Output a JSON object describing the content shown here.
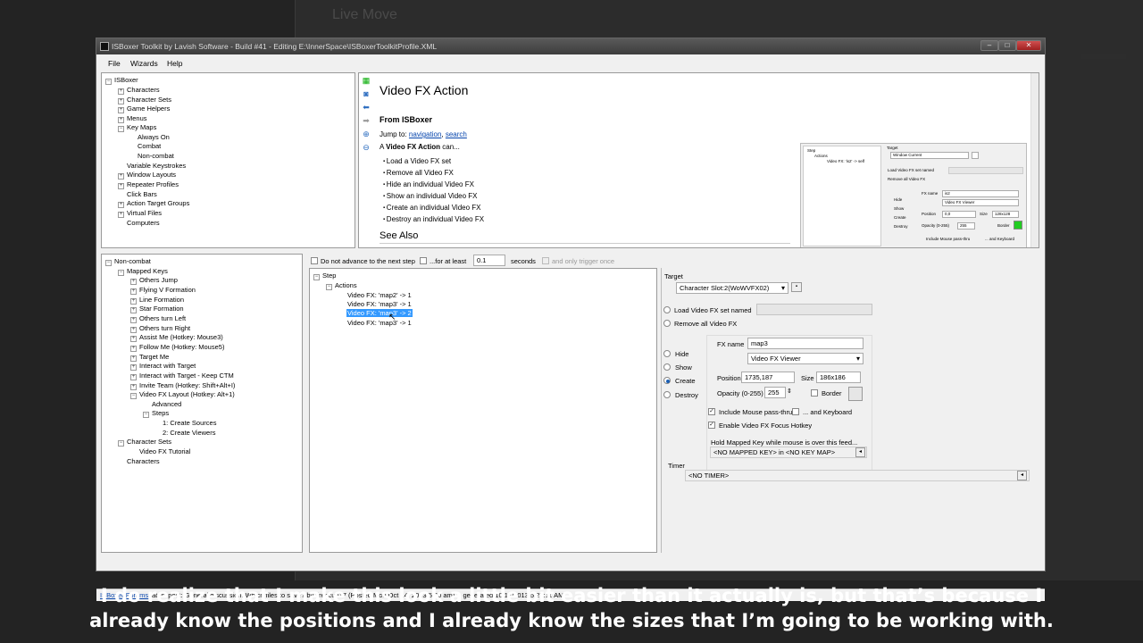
{
  "window": {
    "title": "ISBoxer Toolkit by Lavish Software - Build #41 - Editing E:\\InnerSpace\\ISBoxerToolkitProfile.XML",
    "background_title": "Live Move"
  },
  "menu": [
    "File",
    "Wizards",
    "Help"
  ],
  "top_tree": {
    "root": "ISBoxer",
    "items": [
      "Characters",
      "Character Sets",
      "Game Helpers",
      "Menus",
      "Key Maps",
      "Always On",
      "Combat",
      "Non-combat",
      "Variable Keystrokes",
      "Window Layouts",
      "Repeater Profiles",
      "Click Bars",
      "Action Target Groups",
      "Virtual Files",
      "Computers"
    ]
  },
  "help": {
    "title": "Video FX Action",
    "section": "From ISBoxer",
    "jump_to": "Jump to:",
    "nav_link": "navigation",
    "search_link": "search",
    "intro_bold": "Video FX Action",
    "intro_rest": "can...",
    "bullets": [
      "Load a Video FX set",
      "Remove all Video FX",
      "Hide an individual Video FX",
      "Show an individual Video FX",
      "Create an individual Video FX",
      "Destroy an individual Video FX"
    ],
    "see_also": "See Also"
  },
  "bottom_tree": {
    "root": "Non-combat",
    "items": [
      "Mapped Keys",
      "Others Jump",
      "Flying V Formation",
      "Line Formation",
      "Star Formation",
      "Others turn Left",
      "Others turn Right",
      "Assist Me (Hotkey: Mouse3)",
      "Follow Me (Hotkey: Mouse5)",
      "Target Me",
      "Interact with Target",
      "Interact with Target - Keep CTM",
      "Invite Team (Hotkey: Shift+Alt+I)",
      "Video FX Layout (Hotkey: Alt+1)",
      "Advanced",
      "Steps",
      "1: Create Sources",
      "2: Create Viewers",
      "Character Sets",
      "Video FX Tutorial",
      "Characters"
    ]
  },
  "step_options": {
    "no_advance": "Do not advance to the next step",
    "for_at_least": "...for at least",
    "seconds_value": "0.1",
    "seconds": "seconds",
    "only_once": "and only trigger once"
  },
  "step_tree": {
    "step": "Step",
    "actions": "Actions",
    "items": [
      "Video FX: 'map2' -> 1",
      "Video FX: 'map3' -> 1",
      "Video FX: 'map3' -> 2",
      "Video FX: 'map3' -> 1"
    ]
  },
  "action": {
    "target_label": "Target",
    "target_value": "Character Slot:2(WoWVFX02)",
    "load_set": "Load Video FX set named",
    "remove_all": "Remove all Video FX",
    "hide": "Hide",
    "show": "Show",
    "create": "Create",
    "destroy": "Destroy",
    "fx_name_label": "FX name",
    "fx_name": "map3",
    "fx_type": "Video FX Viewer",
    "position_label": "Position",
    "position": "1735,187",
    "size_label": "Size",
    "size": "186x186",
    "opacity_label": "Opacity (0-255)",
    "opacity": "255",
    "border": "Border",
    "mouse_passthru": "Include Mouse pass-thru",
    "and_keyboard": "... and Keyboard",
    "focus_hotkey": "Enable Video FX Focus Hotkey",
    "hold_mapped": "Hold Mapped Key while mouse is over this feed...",
    "mapped_key": "<NO MAPPED KEY> in <NO KEY MAP>",
    "timer_label": "Timer",
    "timer": "<NO TIMER>"
  },
  "status": {
    "link": "ISBoxer Forums",
    "text": "latest post: General discussion: Which files to save? by firescue17 (Posted Mon Oct 14, 2013 5:00 am) -- generated 10/14/2013 5:27:11 AM"
  },
  "subtitles": {
    "line1": "I do realize that I make this look a little bit easier than it actually is, but that’s because I",
    "line2": "already know the positions and I already know the sizes that I’m going to be working with."
  },
  "thumb": {
    "step": "Step",
    "actions": "Actions",
    "item": "Video FX: 'is2' -> self",
    "target": "Target",
    "target_value": "Window Current",
    "load": "Load Video FX set named",
    "remove": "Remove all Video FX",
    "hide": "Hide",
    "show": "Show",
    "create": "Create",
    "destroy": "Destroy",
    "fx_name": "FX name",
    "fx_value": "is2",
    "fx_type": "Video FX Viewer",
    "position": "Position",
    "position_value": "0,0",
    "size": "Size",
    "size_value": "128x128",
    "opacity": "Opacity (0-255)",
    "opacity_value": "255",
    "border": "Border",
    "mouse": "Include Mouse pass-thru",
    "keyboard": "... and Keyboard"
  },
  "colors": {
    "selection": "#3399ff",
    "link": "#0645ad",
    "titlebar": "#4a4a4a",
    "border_swatch": "#22cc22"
  }
}
